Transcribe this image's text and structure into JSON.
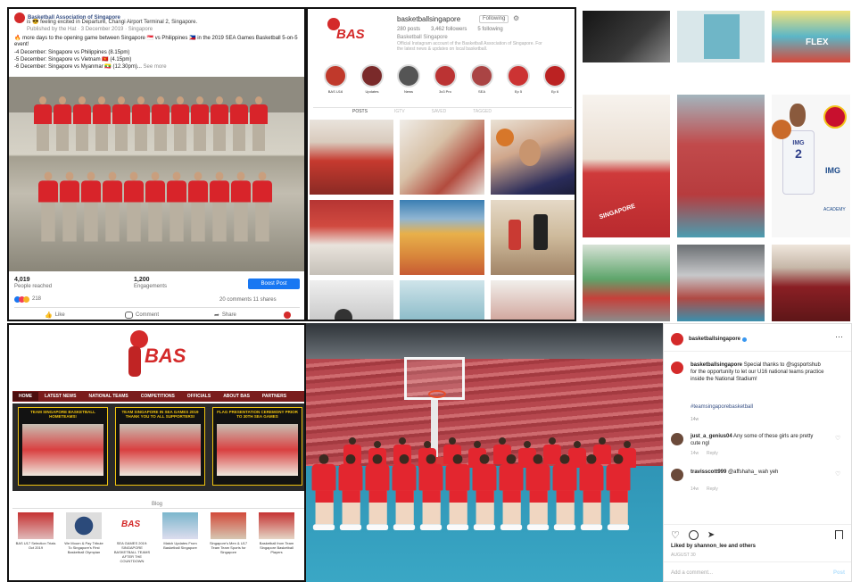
{
  "facebook": {
    "page_name": "Basketball Association of Singapore",
    "line1": "is 😎 feeling excited in Departure, Changi Airport Terminal 2, Singapore.",
    "line2": "Published by the Hat · 3 December 2019 · Singapore",
    "line3": "🔥 more days to the opening game between Singapore 🇸🇬 vs Philippines 🇵🇭 in the 2019 SEA Games Basketball 5-on-5 event!",
    "line4": "-4 December: Singapore vs Philippines (8.15pm)",
    "line5": "-5 December: Singapore vs Vietnam 🇻🇳 (4.15pm)",
    "line6": "-6 December: Singapore vs Myanmar 🇲🇲 (12.30pm)...",
    "see_more": "See more",
    "reached_count": "4,019",
    "reached_label": "People reached",
    "engagements_count": "1,200",
    "engagements_label": "Engagements",
    "boost_label": "Boost Post",
    "reactions_count": "218",
    "comments_shares": "20 comments 11 shares",
    "like_label": "Like",
    "comment_label": "Comment",
    "share_label": "Share"
  },
  "instagram_profile": {
    "username": "basketballsingapore",
    "follow_label": "Following",
    "stats": [
      "280 posts",
      "3,462 followers",
      "5 following"
    ],
    "bio_name": "Basketball Singapore",
    "bio_text": "Official Instagram account of the Basketball Association of Singapore. For the latest news & updates on local basketball.",
    "logo_text": "BAS",
    "highlights": [
      "BAS U16",
      "Updates",
      "News",
      "3x3 Pro",
      "SEA",
      "Ep 5",
      "Ep 6"
    ],
    "tabs": [
      "POSTS",
      "IGTV",
      "SAVED",
      "TAGGED"
    ]
  },
  "grid_third": {
    "poster_text": "FLEX",
    "sign_text": "SINGAPORE",
    "jersey_number": "2",
    "jersey_text": "IMG",
    "img_logo": "IMG",
    "academy_text": "ACADEMY"
  },
  "website": {
    "logo_text": "BAS",
    "nav": [
      "HOME",
      "LATEST NEWS",
      "NATIONAL TEAMS",
      "COMPETITIONS",
      "OFFICIALS",
      "ABOUT BAS",
      "PARTNERS"
    ],
    "news_headlines": [
      "TEAM SINGAPORE BASKETBALL HOMETEAMS!",
      "TEAM SINGAPORE IN SEA GAMES 2019 THANK YOU TO ALL SUPPORTERS!",
      "FLAG PRESENTATION CEREMONY PRIOR TO 30TH SEA GAMES"
    ],
    "section_label": "Blog",
    "thumb_captions": [
      "BAS U17 Selection Trials Oct 2019",
      "We Mourn & Pay Tribute To Singapore's First Basketball Olympian",
      "SEA GAMES 2019: SINGAPORE BASKETBALL TEAMS AFTER THE COUNTDOWN",
      "Match Updates From Basketball Singapore",
      "Singapore's Men & U17 Team Team Sports for Singapore",
      "Basketball from Team Singapore Basketball Players"
    ],
    "thumb_logo_text": "BAS"
  },
  "instagram_post": {
    "username": "basketballsingapore",
    "more_label": "···",
    "caption_user": "basketballsingapore",
    "caption_text": "Special thanks to @sgsportshub for the opportunity to let our U16 national teams practice inside the National Stadium!",
    "hashtag": "#teamsingaporebasketball",
    "caption_time": "14w",
    "comments": [
      {
        "user": "just_a_genius04",
        "text": "Any some of these girls are pretty cute ngl",
        "time": "14w",
        "reply": "Reply"
      },
      {
        "user": "travisscott999",
        "text": "@affshaha_ wah yeh",
        "time": "14w",
        "reply": "Reply"
      }
    ],
    "likes_text": "Liked by shannon_lee and others",
    "post_date": "AUGUST 30",
    "add_comment": "Add a comment...",
    "post_label": "Post"
  },
  "colors": {
    "bas_red": "#d42a2a",
    "fb_blue": "#1877f2",
    "ig_link": "#385185",
    "web_nav": "#7a1d1d",
    "court_teal": "#3aa7c5"
  }
}
